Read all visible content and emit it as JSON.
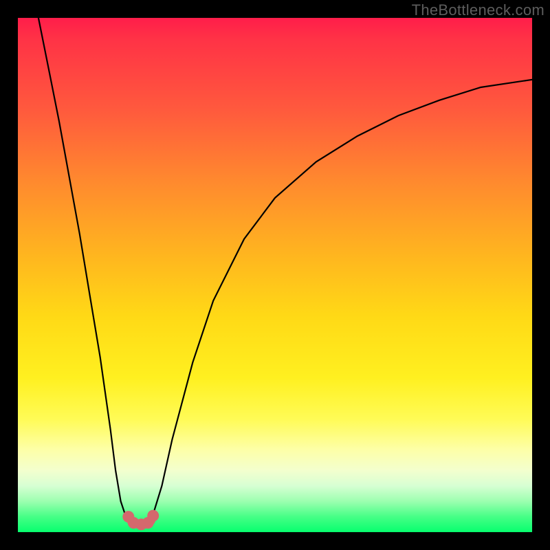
{
  "watermark": "TheBottleneck.com",
  "chart_data": {
    "type": "line",
    "title": "",
    "xlabel": "",
    "ylabel": "",
    "xlim": [
      0,
      100
    ],
    "ylim": [
      0,
      100
    ],
    "note": "No numeric axes or tick labels are visible; values below are estimated from pixel geometry of the V-shaped curve. x is horizontal percent, y is vertical percent where 0 = bottom of colored area and 100 = top.",
    "series": [
      {
        "name": "left-branch",
        "x": [
          4,
          6,
          8,
          10,
          12,
          14,
          16,
          18,
          19,
          20,
          21,
          22
        ],
        "y": [
          100,
          90,
          80,
          69,
          58,
          46,
          34,
          20,
          12,
          6,
          3,
          2
        ]
      },
      {
        "name": "valley-floor",
        "x": [
          22,
          23,
          24,
          25,
          26
        ],
        "y": [
          2,
          1.5,
          1.5,
          1.8,
          2.2
        ]
      },
      {
        "name": "right-branch",
        "x": [
          26,
          28,
          30,
          34,
          38,
          44,
          50,
          58,
          66,
          74,
          82,
          90,
          100
        ],
        "y": [
          2.5,
          9,
          18,
          33,
          45,
          57,
          65,
          72,
          77,
          81,
          84,
          86.5,
          88
        ]
      }
    ],
    "markers": {
      "name": "valley-dots",
      "color": "#d4686d",
      "points": [
        {
          "x": 21.5,
          "y": 3.0
        },
        {
          "x": 22.5,
          "y": 1.8
        },
        {
          "x": 24.0,
          "y": 1.5
        },
        {
          "x": 25.3,
          "y": 1.8
        },
        {
          "x": 26.3,
          "y": 3.2
        }
      ]
    }
  }
}
